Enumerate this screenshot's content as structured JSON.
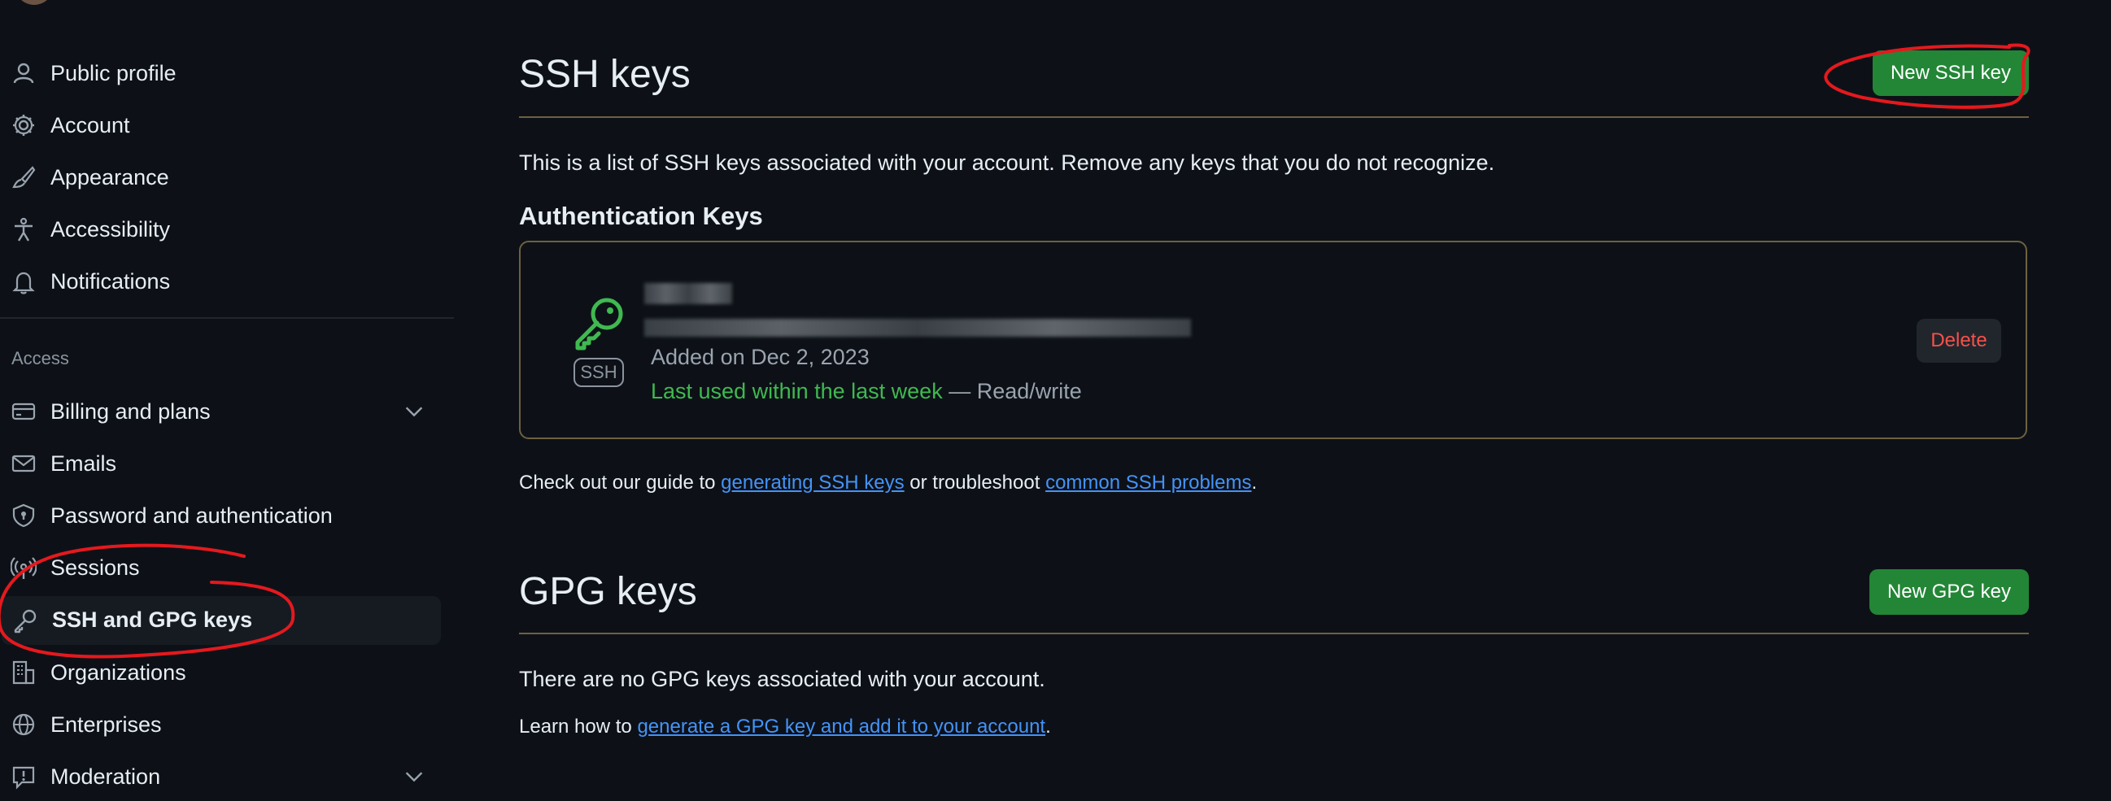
{
  "sidebar": {
    "items_top": [
      {
        "label": "Public profile",
        "icon": "person-icon"
      },
      {
        "label": "Account",
        "icon": "gear-icon"
      },
      {
        "label": "Appearance",
        "icon": "paintbrush-icon"
      },
      {
        "label": "Accessibility",
        "icon": "accessibility-icon"
      },
      {
        "label": "Notifications",
        "icon": "bell-icon"
      }
    ],
    "section_access": "Access",
    "items_access": [
      {
        "label": "Billing and plans",
        "icon": "credit-card-icon",
        "expandable": true
      },
      {
        "label": "Emails",
        "icon": "mail-icon"
      },
      {
        "label": "Password and authentication",
        "icon": "shield-lock-icon"
      },
      {
        "label": "Sessions",
        "icon": "broadcast-icon"
      },
      {
        "label": "SSH and GPG keys",
        "icon": "key-icon",
        "active": true
      },
      {
        "label": "Organizations",
        "icon": "organization-icon"
      },
      {
        "label": "Enterprises",
        "icon": "globe-icon"
      },
      {
        "label": "Moderation",
        "icon": "report-icon",
        "expandable": true
      }
    ]
  },
  "ssh": {
    "title": "SSH keys",
    "new_button": "New SSH key",
    "description": "This is a list of SSH keys associated with your account. Remove any keys that you do not recognize.",
    "auth_heading": "Authentication Keys",
    "key": {
      "badge": "SSH",
      "added": "Added on Dec 2, 2023",
      "last_used": "Last used within the last week",
      "access": " — Read/write",
      "delete_label": "Delete"
    },
    "guide_prefix": "Check out our guide to ",
    "guide_link1": "generating SSH keys",
    "guide_middle": " or troubleshoot ",
    "guide_link2": "common SSH problems",
    "guide_suffix": "."
  },
  "gpg": {
    "title": "GPG keys",
    "new_button": "New GPG key",
    "empty": "There are no GPG keys associated with your account.",
    "learn_prefix": "Learn how to ",
    "learn_link": "generate a GPG key and add it to your account",
    "learn_suffix": "."
  },
  "colors": {
    "background": "#0d1117",
    "accent_green": "#238636",
    "link": "#4493f8",
    "danger": "#f85149",
    "annotation_red": "#e5191e"
  }
}
